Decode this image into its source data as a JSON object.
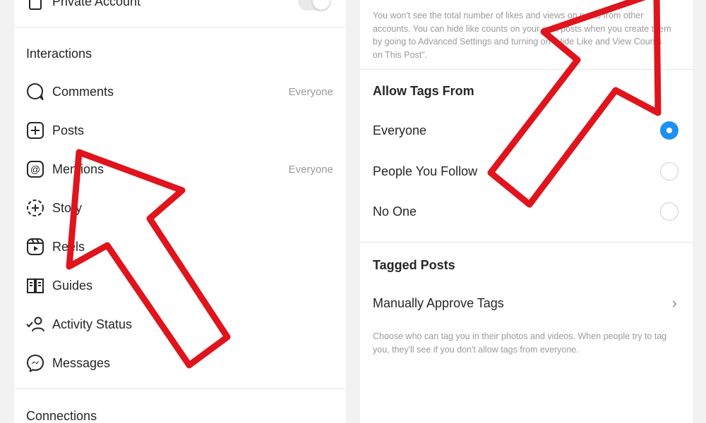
{
  "left": {
    "private_account_label": "Private Account",
    "interactions_title": "Interactions",
    "items": [
      {
        "label": "Comments",
        "value": "Everyone",
        "icon": "comment-icon"
      },
      {
        "label": "Posts",
        "value": "",
        "icon": "plus-square-icon"
      },
      {
        "label": "Mentions",
        "value": "Everyone",
        "icon": "at-sign-icon"
      },
      {
        "label": "Story",
        "value": "",
        "icon": "story-add-icon"
      },
      {
        "label": "Reels",
        "value": "",
        "icon": "reels-icon"
      },
      {
        "label": "Guides",
        "value": "",
        "icon": "guides-icon"
      },
      {
        "label": "Activity Status",
        "value": "",
        "icon": "activity-status-icon"
      },
      {
        "label": "Messages",
        "value": "",
        "icon": "messenger-icon"
      }
    ],
    "connections_title": "Connections"
  },
  "right": {
    "like_counts_note": "You won't see the total number of likes and views on posts from other accounts. You can hide like counts on your own posts when you create them by going to Advanced Settings and turning on \"Hide Like and View Counts on This Post\".",
    "allow_tags_title": "Allow Tags From",
    "options": [
      {
        "label": "Everyone",
        "selected": true
      },
      {
        "label": "People You Follow",
        "selected": false
      },
      {
        "label": "No One",
        "selected": false
      }
    ],
    "tagged_posts_title": "Tagged Posts",
    "manual_approve_label": "Manually Approve Tags",
    "tags_note": "Choose who can tag you in their photos and videos. When people try to tag you, they'll see if you don't allow tags from everyone."
  },
  "colors": {
    "accent_blue": "#1f8ff2",
    "annotation_red": "#e0141c",
    "muted_text": "#9a9a9a"
  }
}
